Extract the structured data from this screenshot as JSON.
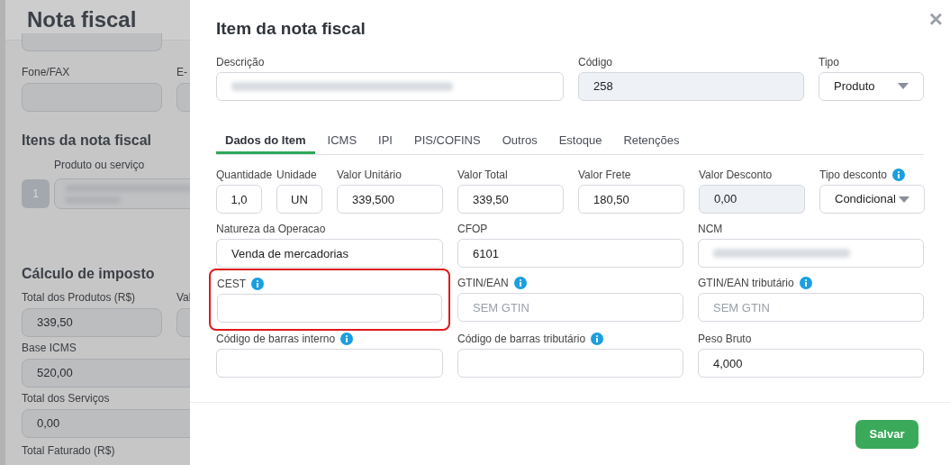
{
  "background_page": {
    "title": "Nota fiscal",
    "rows": [
      {
        "kind": "stub"
      },
      {
        "kind": "pair",
        "fields": [
          {
            "label": "Fone/FAX"
          },
          {
            "label": "E-"
          }
        ]
      },
      {
        "kind": "heading",
        "text": "Itens da nota fiscal"
      },
      {
        "kind": "item",
        "label": "Produto ou serviço",
        "number": "1",
        "redacted": true
      },
      {
        "kind": "heading",
        "text": "Cálculo de imposto"
      },
      {
        "kind": "pair",
        "fields": [
          {
            "label": "Total dos Produtos (R$)",
            "value": "339,50"
          },
          {
            "label": "Val"
          }
        ]
      },
      {
        "kind": "wide",
        "label": "Base ICMS",
        "value": "520,00"
      },
      {
        "kind": "wide",
        "label": "Total dos Serviços",
        "value": "0,00"
      },
      {
        "kind": "label",
        "text": "Total Faturado (R$)"
      }
    ]
  },
  "modal": {
    "title": "Item da nota fiscal",
    "close": "×",
    "top_fields": [
      {
        "label": "Descrição",
        "kind": "text",
        "redacted": true
      },
      {
        "label": "Código",
        "kind": "readonly",
        "value": "258"
      },
      {
        "label": "Tipo",
        "kind": "select",
        "value": "Produto"
      }
    ],
    "tabs": [
      {
        "label": "Dados do Item",
        "selected": true
      },
      {
        "label": "ICMS",
        "selected": false
      },
      {
        "label": "IPI",
        "selected": false
      },
      {
        "label": "PIS/COFINS",
        "selected": false
      },
      {
        "label": "Outros",
        "selected": false
      },
      {
        "label": "Estoque",
        "selected": false
      },
      {
        "label": "Retenções",
        "selected": false
      }
    ],
    "rows": [
      {
        "fields": [
          {
            "label": "Quantidade",
            "kind": "short",
            "value": "1,0"
          },
          {
            "label": "Unidade",
            "kind": "short",
            "value": "UN"
          },
          {
            "label": "Valor Unitário",
            "kind": "text",
            "value": "339,500"
          },
          {
            "label": "Valor Total",
            "kind": "text",
            "value": "339,50"
          },
          {
            "label": "Valor Frete",
            "kind": "text",
            "value": "180,50"
          },
          {
            "label": "Valor Desconto",
            "kind": "readonly",
            "value": "0,00"
          },
          {
            "label": "Tipo desconto",
            "kind": "select",
            "value": "Condicional",
            "info": true
          }
        ]
      },
      {
        "fields": [
          {
            "label": "Natureza da Operacao",
            "kind": "text",
            "value": "Venda de mercadorias"
          },
          {
            "label": "CFOP",
            "kind": "text",
            "value": "6101"
          },
          {
            "label": "NCM",
            "kind": "text",
            "redacted": true
          }
        ]
      },
      {
        "fields": [
          {
            "label": "CEST",
            "kind": "text",
            "info": true,
            "highlighted": true
          },
          {
            "label": "GTIN/EAN",
            "kind": "text",
            "placeholder": "SEM GTIN",
            "info": true
          },
          {
            "label": "GTIN/EAN tributário",
            "kind": "text",
            "placeholder": "SEM GTIN",
            "info": true
          }
        ]
      },
      {
        "fields": [
          {
            "label": "Código de barras interno",
            "kind": "text",
            "info": true
          },
          {
            "label": "Código de barras tributário",
            "kind": "text",
            "info": true
          },
          {
            "label": "Peso Bruto",
            "kind": "text",
            "value": "4,000"
          }
        ]
      }
    ],
    "save_button": "Salvar"
  }
}
